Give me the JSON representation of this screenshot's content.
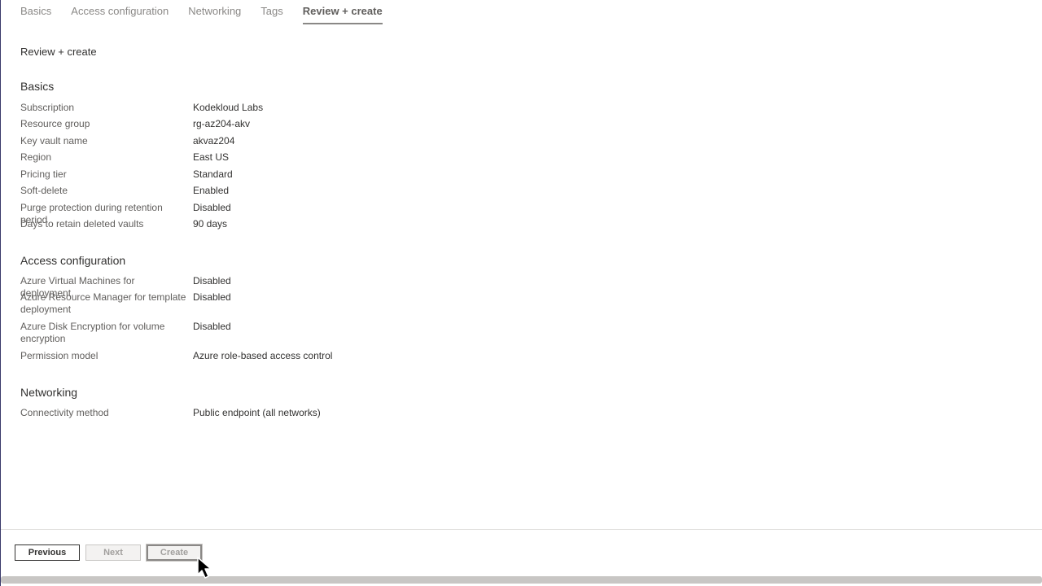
{
  "tabs": [
    {
      "label": "Basics"
    },
    {
      "label": "Access configuration"
    },
    {
      "label": "Networking"
    },
    {
      "label": "Tags"
    },
    {
      "label": "Review + create",
      "active": true
    }
  ],
  "page_heading": "Review + create",
  "sections": {
    "basics": {
      "title": "Basics",
      "rows": [
        {
          "label": "Subscription",
          "value": "Kodekloud Labs"
        },
        {
          "label": "Resource group",
          "value": "rg-az204-akv"
        },
        {
          "label": "Key vault name",
          "value": "akvaz204"
        },
        {
          "label": "Region",
          "value": "East US"
        },
        {
          "label": "Pricing tier",
          "value": "Standard"
        },
        {
          "label": "Soft-delete",
          "value": "Enabled"
        },
        {
          "label": "Purge protection during retention period",
          "value": "Disabled"
        },
        {
          "label": "Days to retain deleted vaults",
          "value": "90 days"
        }
      ]
    },
    "access": {
      "title": "Access configuration",
      "rows": [
        {
          "label": "Azure Virtual Machines for deployment",
          "value": "Disabled"
        },
        {
          "label": "Azure Resource Manager for template deployment",
          "value": "Disabled"
        },
        {
          "label": "Azure Disk Encryption for volume encryption",
          "value": "Disabled"
        },
        {
          "label": "Permission model",
          "value": "Azure role-based access control"
        }
      ]
    },
    "networking": {
      "title": "Networking",
      "rows": [
        {
          "label": "Connectivity method",
          "value": "Public endpoint (all networks)"
        }
      ]
    }
  },
  "footer": {
    "previous_label": "Previous",
    "next_label": "Next",
    "create_label": "Create"
  },
  "cursor_icon": "mouse-pointer-icon"
}
